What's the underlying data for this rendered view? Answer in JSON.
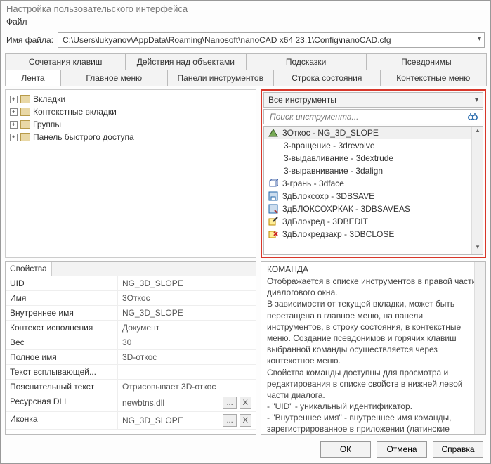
{
  "window": {
    "title": "Настройка пользовательского интерфейса"
  },
  "menu": {
    "file": "Файл"
  },
  "file": {
    "label": "Имя файла:",
    "path": "C:\\Users\\lukyanov\\AppData\\Roaming\\Nanosoft\\nanoCAD x64 23.1\\Config\\nanoCAD.cfg"
  },
  "tabs_top": {
    "t0": "Сочетания клавиш",
    "t1": "Действия над объектами",
    "t2": "Подсказки",
    "t3": "Псевдонимы"
  },
  "tabs_bottom": {
    "t0": "Лента",
    "t1": "Главное меню",
    "t2": "Панели инструментов",
    "t3": "Строка состояния",
    "t4": "Контекстные меню"
  },
  "tree": {
    "n0": "Вкладки",
    "n1": "Контекстные вкладки",
    "n2": "Группы",
    "n3": "Панель быстрого доступа"
  },
  "tools": {
    "selector": "Все инструменты",
    "search_ph": "Поиск инструмента...",
    "items": {
      "i0": "3Откос - NG_3D_SLOPE",
      "i1": "3-вращение - 3drevolve",
      "i2": "3-выдавливание - 3dextrude",
      "i3": "3-выравнивание - 3dalign",
      "i4": "3-грань - 3dface",
      "i5": "3дБлоксохр - 3DBSAVE",
      "i6": "3дБЛОКСОХРКАК - 3DBSAVEAS",
      "i7": "3дБлокред - 3DBEDIT",
      "i8": "3дБлокредзакр - 3DBCLOSE"
    }
  },
  "props": {
    "panel_title": "Свойства",
    "rows": {
      "uid_k": "UID",
      "uid_v": "NG_3D_SLOPE",
      "name_k": "Имя",
      "name_v": "3Откос",
      "iname_k": "Внутреннее имя",
      "iname_v": "NG_3D_SLOPE",
      "ctx_k": "Контекст исполнения",
      "ctx_v": "Документ",
      "weight_k": "Вес",
      "weight_v": "30",
      "fname_k": "Полное имя",
      "fname_v": "3D-откос",
      "tip_k": "Текст всплывающей...",
      "tip_v": "",
      "expl_k": "Пояснительный текст",
      "expl_v": "Отрисовывает 3D-откос",
      "dll_k": "Ресурсная DLL",
      "dll_v": "newbtns.dll",
      "icon_k": "Иконка",
      "icon_v": "NG_3D_SLOPE"
    },
    "dots": "...",
    "x": "X"
  },
  "help": {
    "title": "КОМАНДА",
    "p1": "Отображается в списке инструментов в правой части диалогового окна.",
    "p2": "В зависимости от текущей вкладки, может быть перетащена в главное меню, на панели инструментов, в строку состояния, в контекстные меню. Создание псевдонимов и горячих клавиш выбранной команды осуществляется через контекстное меню.",
    "p3": "Свойства команды доступны для просмотра и редактирования в списке свойств в нижней левой части диалога.",
    "p4": "  - \"UID\" - уникальный идентификатор.",
    "p5": "  - \"Внутреннее имя\" - внутреннее имя команды, зарегистрированное в приложении (латинские символы без пробелов). Часто совпадает с UID. Может"
  },
  "buttons": {
    "ok": "ОК",
    "cancel": "Отмена",
    "help": "Справка"
  }
}
